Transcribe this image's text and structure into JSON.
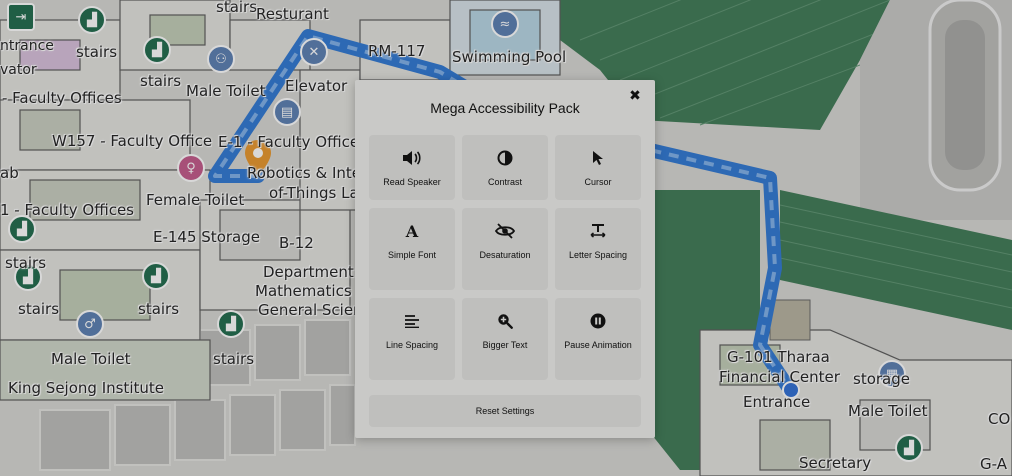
{
  "map": {
    "labels": {
      "stairs_top": "stairs",
      "restaurant": "Resturant",
      "entrance_left": "ntrance",
      "stairs_1": "stairs",
      "room_117": "RM-117",
      "swimming_pool": "Swimming Pool",
      "elevator_left": "vator",
      "stairs_2": "stairs",
      "male_toilet_top": "Male Toilet",
      "elevator": "Elevator",
      "faculty_offices_1": "- Faculty Offices",
      "w157": "W157 - Faculty Office",
      "e_faculty": "E-1 - Faculty Offices",
      "robotics_1": "Robotics & Inter",
      "lab_left": "ab",
      "robotics_2": "of-Things Lab",
      "female_toilet": "Female Toilet",
      "faculty_offices_2": "1 - Faculty Offices",
      "e145": "E-145 Storage",
      "b12": "B-12",
      "stairs_3": "stairs",
      "department_1": "Department",
      "department_2": "Mathematics a",
      "department_3": "General Scien",
      "stairs_4": "stairs",
      "stairs_5": "stairs",
      "male_toilet_bottom": "Male Toilet",
      "stairs_6": "stairs",
      "king_sejong": "King Sejong Institute",
      "tharaa_1": "G-101 Tharaa",
      "tharaa_2": "Financial Center",
      "storage": "storage",
      "entrance_right": "Entrance",
      "male_toilet_right": "Male Toilet",
      "secretary": "Secretary",
      "g_a": "G-A",
      "co": "CO"
    }
  },
  "panel": {
    "title": "Mega Accessibility Pack",
    "close_glyph": "✖",
    "tiles": [
      {
        "label": "Read Speaker",
        "icon": "speaker-icon"
      },
      {
        "label": "Contrast",
        "icon": "contrast-icon"
      },
      {
        "label": "Cursor",
        "icon": "cursor-icon"
      },
      {
        "label": "Simple Font",
        "icon": "font-icon"
      },
      {
        "label": "Desaturation",
        "icon": "desaturation-icon"
      },
      {
        "label": "Letter Spacing",
        "icon": "letter-spacing-icon"
      },
      {
        "label": "Line Spacing",
        "icon": "line-spacing-icon"
      },
      {
        "label": "Bigger Text",
        "icon": "zoom-in-icon"
      },
      {
        "label": "Pause Animation",
        "icon": "pause-icon"
      }
    ],
    "reset_label": "Reset Settings"
  },
  "colors": {
    "route": "#2f78d4",
    "marker": "#e8962b",
    "location_dot": "#2f6fd6",
    "poi_green": "#1f6b4c"
  }
}
